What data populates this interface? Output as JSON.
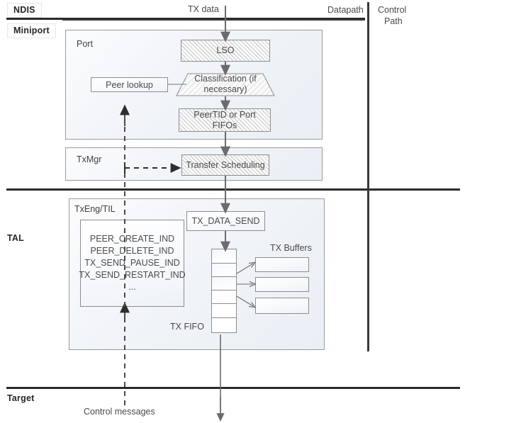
{
  "lanes": {
    "ndis": "NDIS",
    "miniport": "Miniport",
    "tal": "TAL",
    "target": "Target"
  },
  "headers": {
    "datapath": "Datapath",
    "control_path_line1": "Control",
    "control_path_line2": "Path"
  },
  "flow": {
    "tx_data": "TX data",
    "control_messages": "Control messages"
  },
  "miniport": {
    "port_box_title": "Port",
    "lso": "LSO",
    "classification": "Classification (if\nnecessary)",
    "peer_lookup": "Peer lookup",
    "fifos": "PeerTID or Port\nFIFOs",
    "txmgr_box_title": "TxMgr",
    "transfer_scheduling": "Transfer Scheduling"
  },
  "tal": {
    "txeng_box_title": "TxEng/TIL",
    "indications": "PEER_CREATE_IND\nPEER_DELETE_IND\nTX_SEND_PAUSE_IND\nTX_SEND_RESTART_IND\n...",
    "tx_data_send": "TX_DATA_SEND",
    "tx_fifo_label": "TX FIFO",
    "tx_buffers_label": "TX Buffers",
    "fifo_cells": [
      "",
      "",
      "",
      "",
      "",
      ""
    ],
    "tx_buffers": [
      "",
      "",
      ""
    ]
  },
  "colors": {
    "divider": "#2b2b2b",
    "box_border": "#8d8d8d",
    "container_border": "#9a9a9a",
    "text": "#4a4a4a",
    "lane_text": "#262626",
    "connector": "#6b6b6b"
  }
}
